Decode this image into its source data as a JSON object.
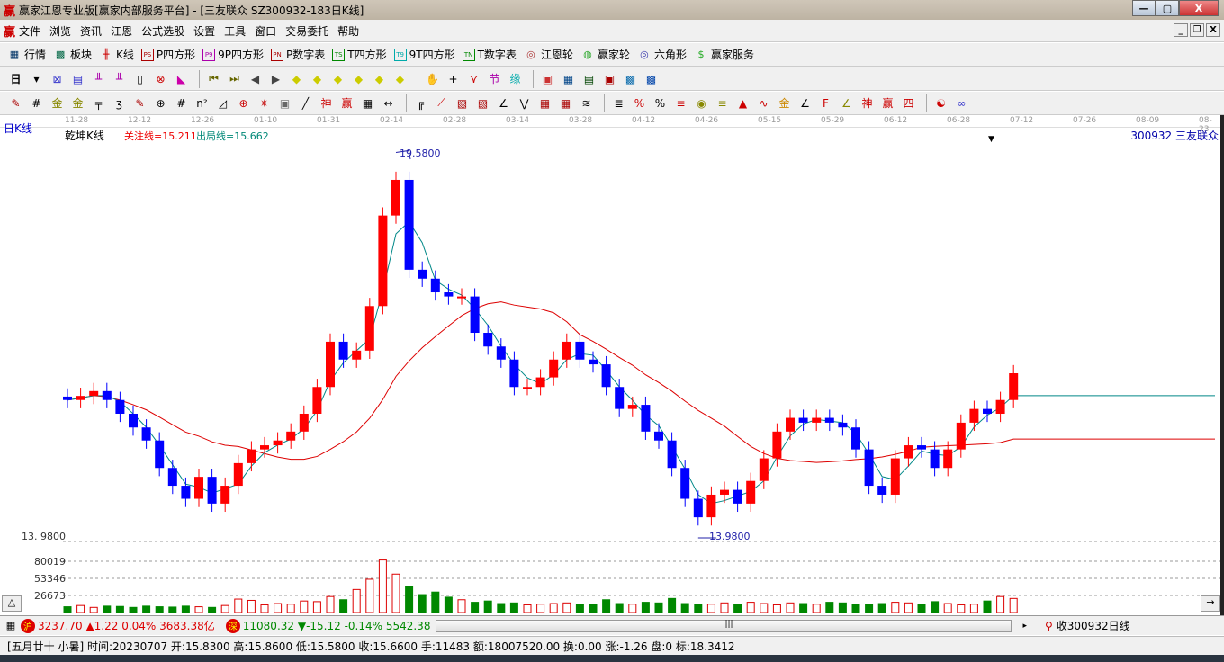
{
  "window": {
    "title": "赢家江恩专业版[赢家内部服务平台] - [三友联众  SZ300932-183日K线]",
    "logo": "赢"
  },
  "menu": [
    "文件",
    "浏览",
    "资讯",
    "江恩",
    "公式选股",
    "设置",
    "工具",
    "窗口",
    "交易委托",
    "帮助"
  ],
  "toolbar1": [
    {
      "icon": "table-icon",
      "glyph": "▦",
      "label": "行情"
    },
    {
      "icon": "blocks-icon",
      "glyph": "▩",
      "label": "板块"
    },
    {
      "icon": "kline-icon",
      "glyph": "╫",
      "label": "K线"
    },
    {
      "icon": "ps-icon",
      "glyph": "PS",
      "label": "P四方形"
    },
    {
      "icon": "p9-icon",
      "glyph": "P9",
      "label": "9P四方形"
    },
    {
      "icon": "pn-icon",
      "glyph": "PN",
      "label": "P数字表"
    },
    {
      "icon": "ts-icon",
      "glyph": "TS",
      "label": "T四方形"
    },
    {
      "icon": "t9-icon",
      "glyph": "T9",
      "label": "9T四方形"
    },
    {
      "icon": "tn-icon",
      "glyph": "TN",
      "label": "T数字表"
    },
    {
      "icon": "gann-wheel-icon",
      "glyph": "◎",
      "label": "江恩轮"
    },
    {
      "icon": "winner-wheel-icon",
      "glyph": "◍",
      "label": "赢家轮"
    },
    {
      "icon": "hexagon-icon",
      "glyph": "◎",
      "label": "六角形"
    },
    {
      "icon": "dollar-icon",
      "glyph": "$",
      "label": "赢家服务"
    }
  ],
  "toolbar2_period": "日",
  "chart": {
    "panel_label": "日K线",
    "indicator_name": "乾坤K线",
    "focus_line": "关注线=15.211",
    "exit_line": "出局线=15.662",
    "stock_label": "300932  三友联众",
    "high_label": "19.5800",
    "low_label": "13.9800",
    "price_axis_label": "13. 9800",
    "vol_ticks": [
      "80019",
      "53346",
      "26673"
    ],
    "dates": [
      "11-28",
      "12-12",
      "12-26",
      "01-10",
      "01-31",
      "02-14",
      "02-28",
      "03-14",
      "03-28",
      "04-12",
      "04-26",
      "05-15",
      "05-29",
      "06-12",
      "06-28",
      "07-12",
      "07-26",
      "08-09",
      "08-23"
    ]
  },
  "chart_data": {
    "type": "candlestick",
    "price_range": [
      13.98,
      19.58
    ],
    "closes": [
      15.99,
      16.05,
      16.12,
      15.99,
      15.79,
      15.59,
      15.4,
      15.0,
      14.74,
      14.55,
      14.87,
      14.48,
      14.74,
      15.07,
      15.27,
      15.33,
      15.4,
      15.53,
      15.79,
      16.18,
      16.84,
      16.58,
      16.71,
      17.36,
      18.68,
      19.2,
      17.89,
      17.76,
      17.56,
      17.5,
      17.5,
      16.97,
      16.77,
      16.58,
      16.18,
      16.18,
      16.32,
      16.58,
      16.84,
      16.58,
      16.51,
      16.18,
      15.86,
      15.92,
      15.53,
      15.4,
      15.0,
      14.55,
      14.28,
      14.61,
      14.68,
      14.48,
      14.81,
      15.14,
      15.53,
      15.73,
      15.66,
      15.73,
      15.66,
      15.59,
      15.27,
      14.74,
      14.61,
      15.14,
      15.33,
      15.27,
      15.0,
      15.27,
      15.66,
      15.86,
      15.79,
      15.99,
      16.38
    ],
    "volumes": [
      9000,
      11000,
      8000,
      10000,
      9500,
      8000,
      10000,
      9000,
      8500,
      10000,
      9000,
      8000,
      11000,
      21000,
      19000,
      12000,
      14000,
      13000,
      18000,
      17000,
      25000,
      20000,
      36000,
      52000,
      82000,
      60000,
      40000,
      28000,
      32000,
      24000,
      20000,
      16000,
      18000,
      14000,
      15000,
      12000,
      13000,
      14000,
      15000,
      13000,
      12000,
      20000,
      14000,
      13000,
      16000,
      15000,
      22000,
      14000,
      12000,
      13000,
      15000,
      13000,
      16000,
      14000,
      12000,
      15000,
      14000,
      13000,
      16000,
      15000,
      12000,
      13000,
      14000,
      16000,
      15000,
      13000,
      17000,
      14000,
      12000,
      13000,
      18000,
      25000,
      22000
    ]
  },
  "ticker": {
    "sh_icon": "沪",
    "sh": "3237.70 ▲1.22 0.04% 3683.38亿",
    "sz_icon": "深",
    "sz": "11080.32 ▼-15.12 -0.14% 5542.38",
    "right": "收300932日线"
  },
  "status": "[五月廿十 小暑] 时间:20230707 开:15.8300 高:15.8600 低:15.5800 收:15.6600 手:11483 额:18007520.00 换:0.00 涨:-1.26 盘:0 标:18.3412"
}
